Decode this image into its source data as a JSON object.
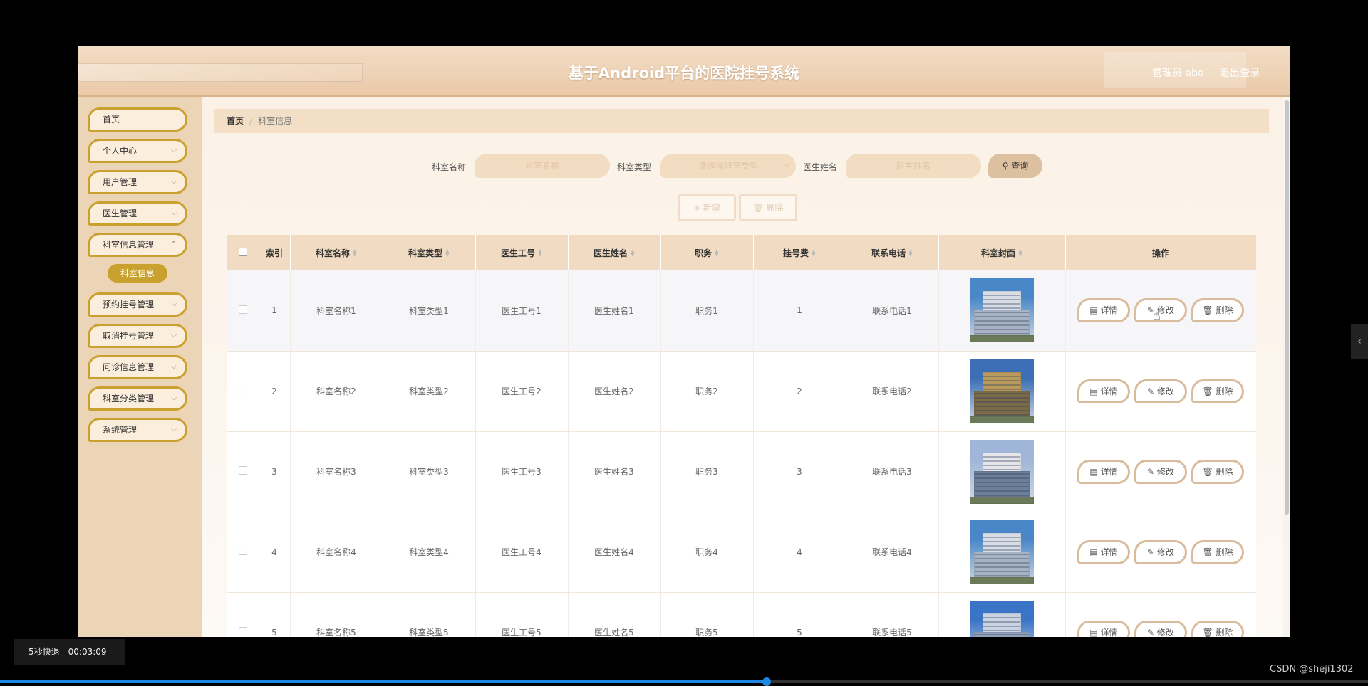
{
  "app": {
    "title": "基于Android平台的医院挂号系统",
    "admin_label": "管理员 abo",
    "logout": "退出登录"
  },
  "sidebar": {
    "items": [
      {
        "label": "首页",
        "has_children": false
      },
      {
        "label": "个人中心",
        "has_children": true
      },
      {
        "label": "用户管理",
        "has_children": true
      },
      {
        "label": "医生管理",
        "has_children": true
      },
      {
        "label": "科室信息管理",
        "has_children": true
      },
      {
        "label": "预约挂号管理",
        "has_children": true
      },
      {
        "label": "取消挂号管理",
        "has_children": true
      },
      {
        "label": "问诊信息管理",
        "has_children": true
      },
      {
        "label": "科室分类管理",
        "has_children": true
      },
      {
        "label": "系统管理",
        "has_children": true
      }
    ],
    "active_sub": "科室信息"
  },
  "breadcrumb": {
    "home": "首页",
    "separator": "/",
    "current": "科室信息"
  },
  "search": {
    "dept_name_label": "科室名称",
    "dept_name_placeholder": "科室名称",
    "dept_type_label": "科室类型",
    "dept_type_placeholder": "请选择科室类型",
    "doctor_name_label": "医生姓名",
    "doctor_name_placeholder": "医生姓名",
    "query_button": "查询"
  },
  "toolbar": {
    "add_button": "+ 新增",
    "delete_button": "删除"
  },
  "table": {
    "columns": [
      "索引",
      "科室名称",
      "科室类型",
      "医生工号",
      "医生姓名",
      "职务",
      "挂号费",
      "联系电话",
      "科室封面",
      "操作"
    ],
    "rows": [
      {
        "index": "1",
        "dept_name": "科室名称1",
        "dept_type": "科室类型1",
        "doctor_id": "医生工号1",
        "doctor_name": "医生姓名1",
        "position": "职务1",
        "fee": "1",
        "phone": "联系电话1"
      },
      {
        "index": "2",
        "dept_name": "科室名称2",
        "dept_type": "科室类型2",
        "doctor_id": "医生工号2",
        "doctor_name": "医生姓名2",
        "position": "职务2",
        "fee": "2",
        "phone": "联系电话2"
      },
      {
        "index": "3",
        "dept_name": "科室名称3",
        "dept_type": "科室类型3",
        "doctor_id": "医生工号3",
        "doctor_name": "医生姓名3",
        "position": "职务3",
        "fee": "3",
        "phone": "联系电话3"
      },
      {
        "index": "4",
        "dept_name": "科室名称4",
        "dept_type": "科室类型4",
        "doctor_id": "医生工号4",
        "doctor_name": "医生姓名4",
        "position": "职务4",
        "fee": "4",
        "phone": "联系电话4"
      },
      {
        "index": "5",
        "dept_name": "科室名称5",
        "dept_type": "科室类型5",
        "doctor_id": "医生工号5",
        "doctor_name": "医生姓名5",
        "position": "职务5",
        "fee": "5",
        "phone": "联系电话5"
      }
    ],
    "actions": {
      "detail": "详情",
      "edit": "修改",
      "delete": "删除"
    }
  },
  "player": {
    "speed_label": "5秒快退",
    "time": "00:03:09",
    "watermark": "CSDN @sheji1302"
  },
  "colors": {
    "accent": "#c9a12e",
    "header": "#eed3b6",
    "sidebar": "#ecd5b6",
    "progress": "#1e88e5"
  }
}
